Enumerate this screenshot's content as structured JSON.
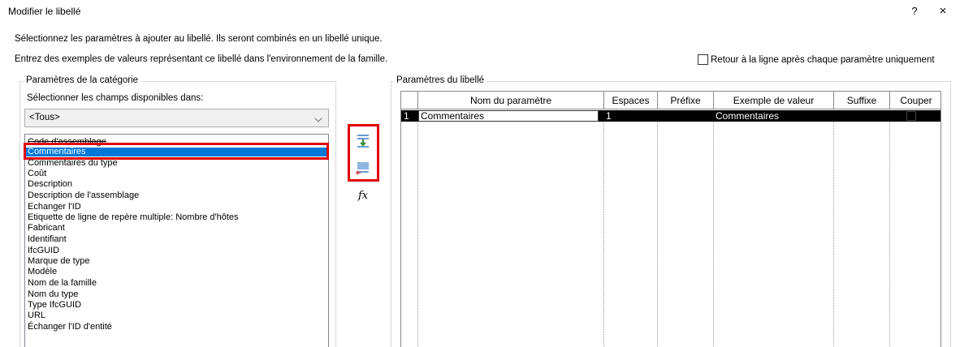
{
  "window": {
    "title": "Modifier le libellé",
    "help": "?",
    "close": "×"
  },
  "instructions": {
    "line1": "Sélectionnez les paramètres à ajouter au libellé. Ils seront combinés en un libellé unique.",
    "line2": "Entrez des exemples de valeurs représentant ce libellé dans l'environnement de la famille."
  },
  "wrap_option": {
    "label": "Retour à la ligne après chaque paramètre uniquement",
    "checked": false
  },
  "category": {
    "group_title": "Paramètres de la catégorie",
    "select_label": "Sélectionner les champs disponibles dans:",
    "dropdown_value": "<Tous>",
    "fields": [
      "Code d'assemblage",
      "Commentaires",
      "Commentaires du type",
      "Coût",
      "Description",
      "Description de l'assemblage",
      "Echanger l'ID",
      "Etiquette de ligne de repère multiple: Nombre d'hôtes",
      "Fabricant",
      "Identifiant",
      "IfcGUID",
      "Marque de type",
      "Modèle",
      "Nom de la famille",
      "Nom du type",
      "Type IfcGUID",
      "URL",
      "Échanger l'ID d'entité"
    ],
    "selected_index": 1
  },
  "actions": {
    "add_icon": "add-parameter-icon",
    "remove_icon": "remove-parameter-icon",
    "fx_label": "fx"
  },
  "label_params": {
    "group_title": "Paramètres du libellé",
    "columns": [
      "Nom du paramètre",
      "Espaces",
      "Préfixe",
      "Exemple de valeur",
      "Suffixe",
      "Couper"
    ],
    "rows": [
      {
        "index": "1",
        "name": "Commentaires",
        "spaces": "1",
        "prefix": "",
        "example": "Commentaires",
        "suffix": "",
        "break": false
      }
    ]
  },
  "colors": {
    "selection": "#0078d7",
    "highlight_box": "#e00000",
    "row_selected": "#000000"
  }
}
